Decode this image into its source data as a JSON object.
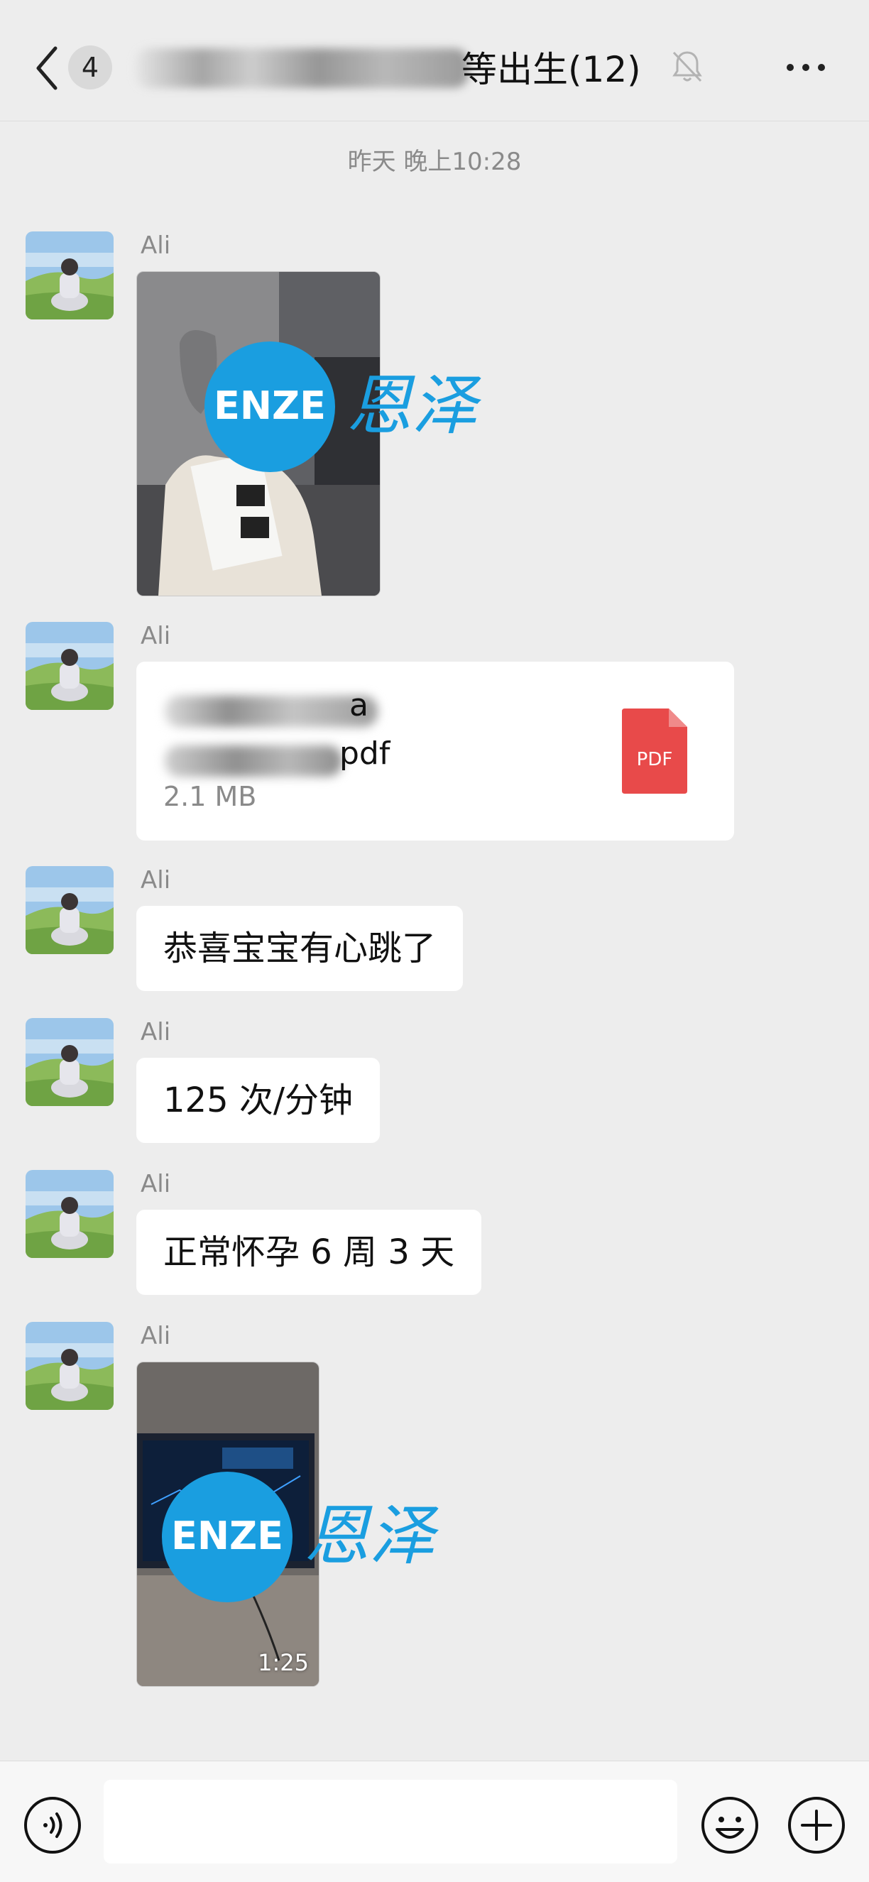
{
  "header": {
    "unread_count": "4",
    "title": "等出生(12)",
    "more_icon": "more-dots-icon",
    "mute_icon": "bell-off-icon"
  },
  "chat": {
    "timestamp": "昨天 晚上10:28",
    "watermark": {
      "logo": "ENZE",
      "brand_cn": "恩泽",
      "color": "#1a9ee0"
    },
    "messages": [
      {
        "sender": "Ali",
        "type": "image"
      },
      {
        "sender": "Ali",
        "type": "file",
        "file_name_line1": "a",
        "file_name_line2": "pdf",
        "file_size": "2.1 MB",
        "file_icon_label": "PDF"
      },
      {
        "sender": "Ali",
        "type": "text",
        "text": "恭喜宝宝有心跳了"
      },
      {
        "sender": "Ali",
        "type": "text",
        "text": "125 次/分钟"
      },
      {
        "sender": "Ali",
        "type": "text",
        "text": "正常怀孕 6 周 3 天"
      },
      {
        "sender": "Ali",
        "type": "video",
        "duration": "1:25"
      }
    ]
  },
  "bottom_bar": {
    "input_placeholder": "",
    "voice_icon": "voice-icon",
    "emoji_icon": "emoji-icon",
    "plus_icon": "plus-icon"
  },
  "colors": {
    "background": "#ededed",
    "bubble": "#ffffff",
    "pdf_red": "#e84a4a",
    "watermark_blue": "#1a9ee0"
  }
}
